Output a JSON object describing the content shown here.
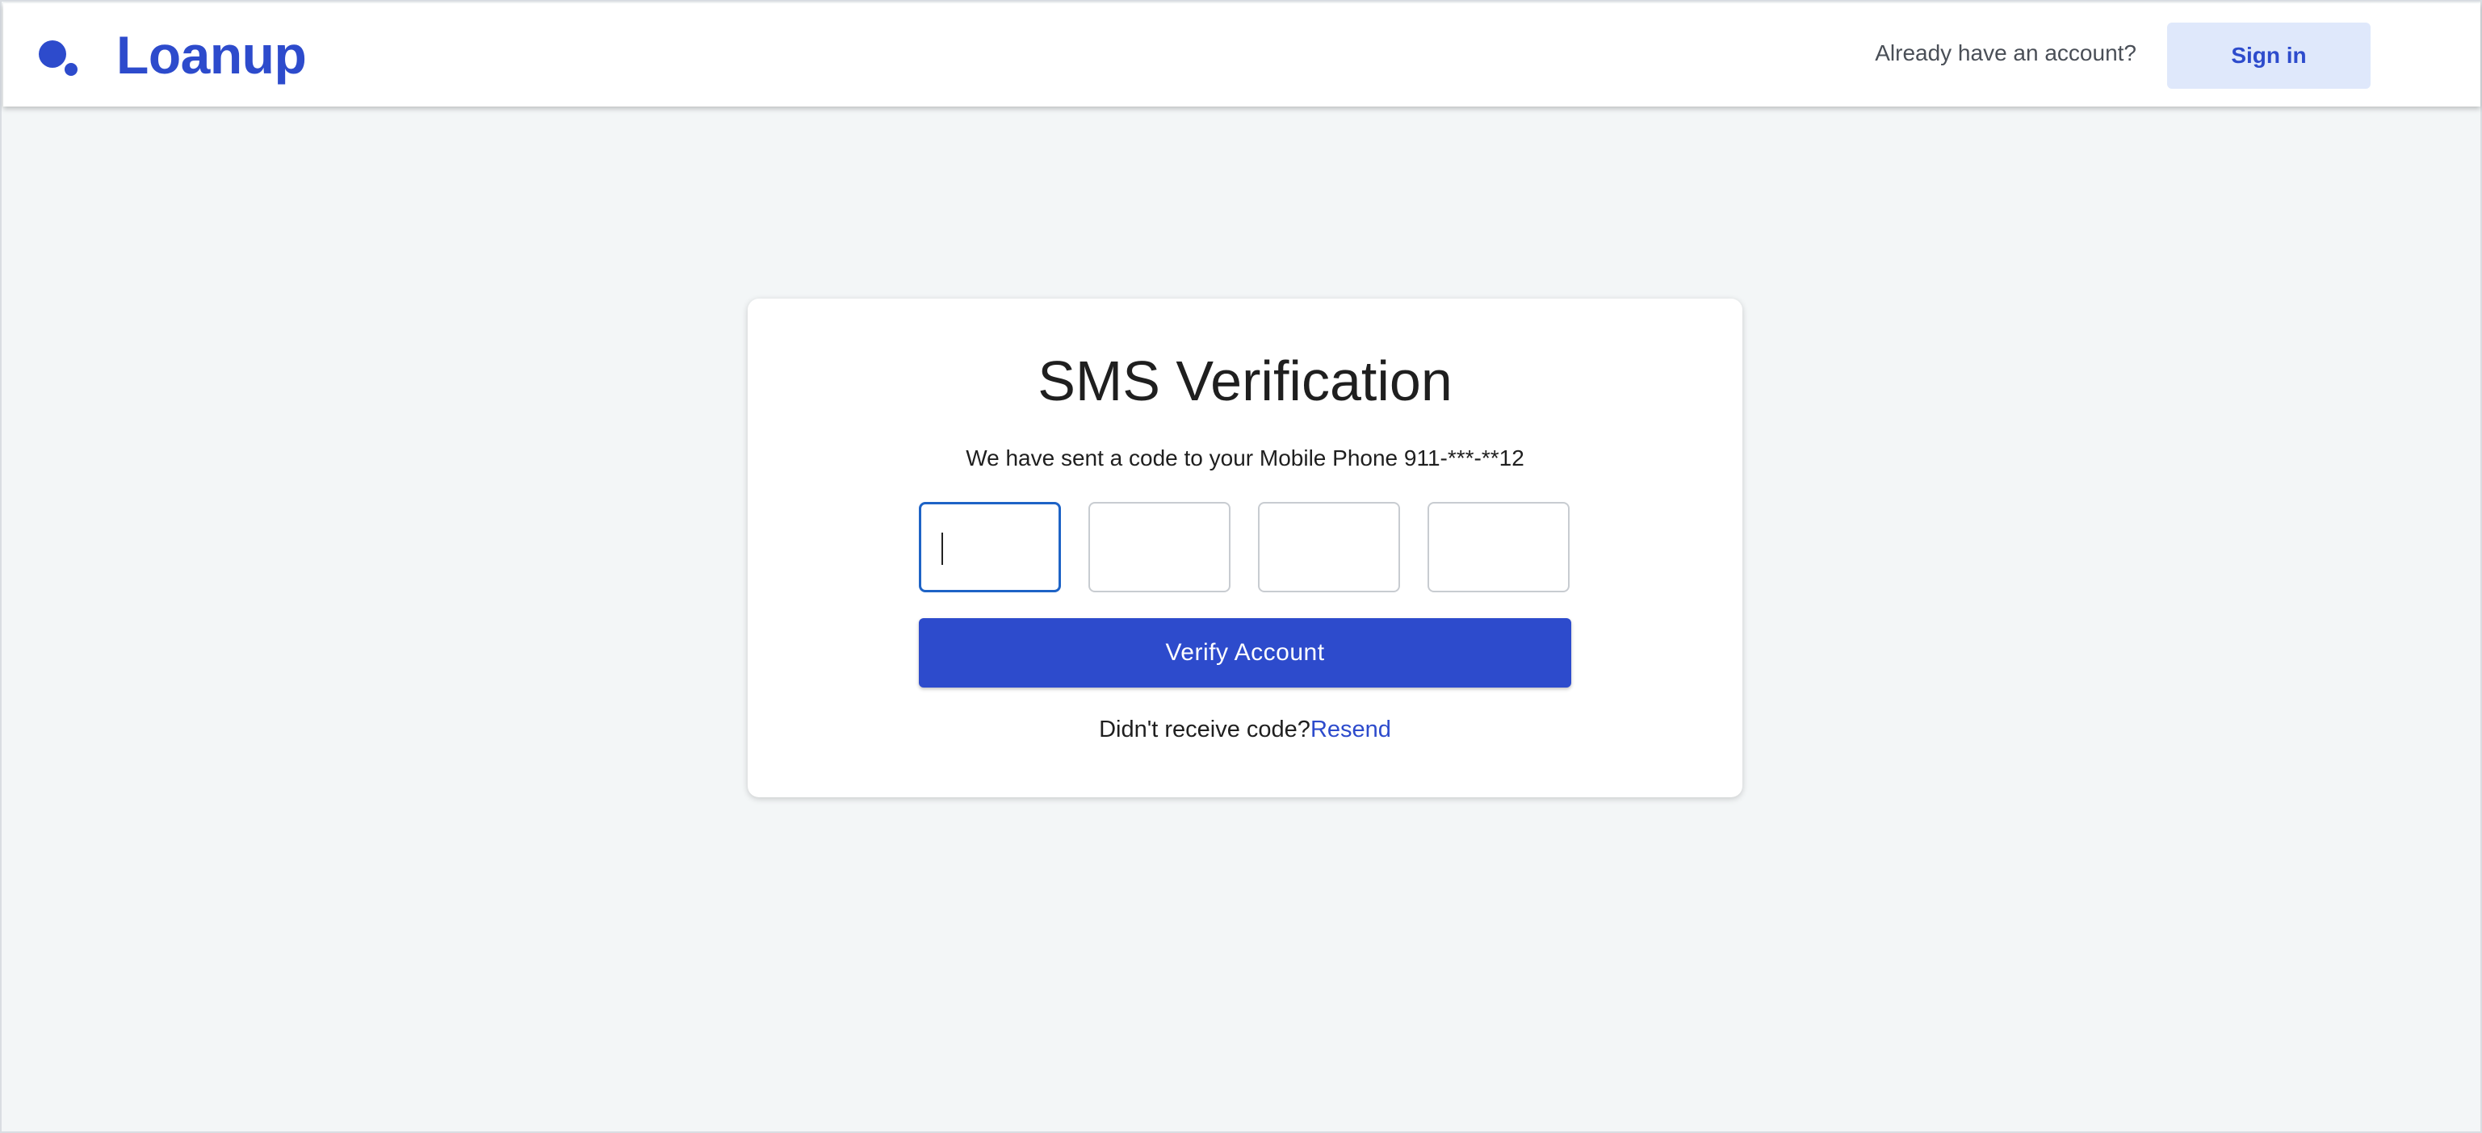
{
  "header": {
    "brand": "Loanup",
    "account_prompt": "Already have an account?",
    "signin_label": "Sign in"
  },
  "verification": {
    "title": "SMS Verification",
    "subtitle": "We have sent a code to your Mobile Phone 911-***-**12",
    "code_digits": [
      "",
      "",
      "",
      ""
    ],
    "verify_label": "Verify Account",
    "resend_prompt": "Didn't receive code?",
    "resend_label": "Resend"
  },
  "colors": {
    "brand": "#2d4bcc",
    "background": "#f3f6f7",
    "signin_bg": "#dfe8fb",
    "focus_border": "#1e63c6"
  }
}
